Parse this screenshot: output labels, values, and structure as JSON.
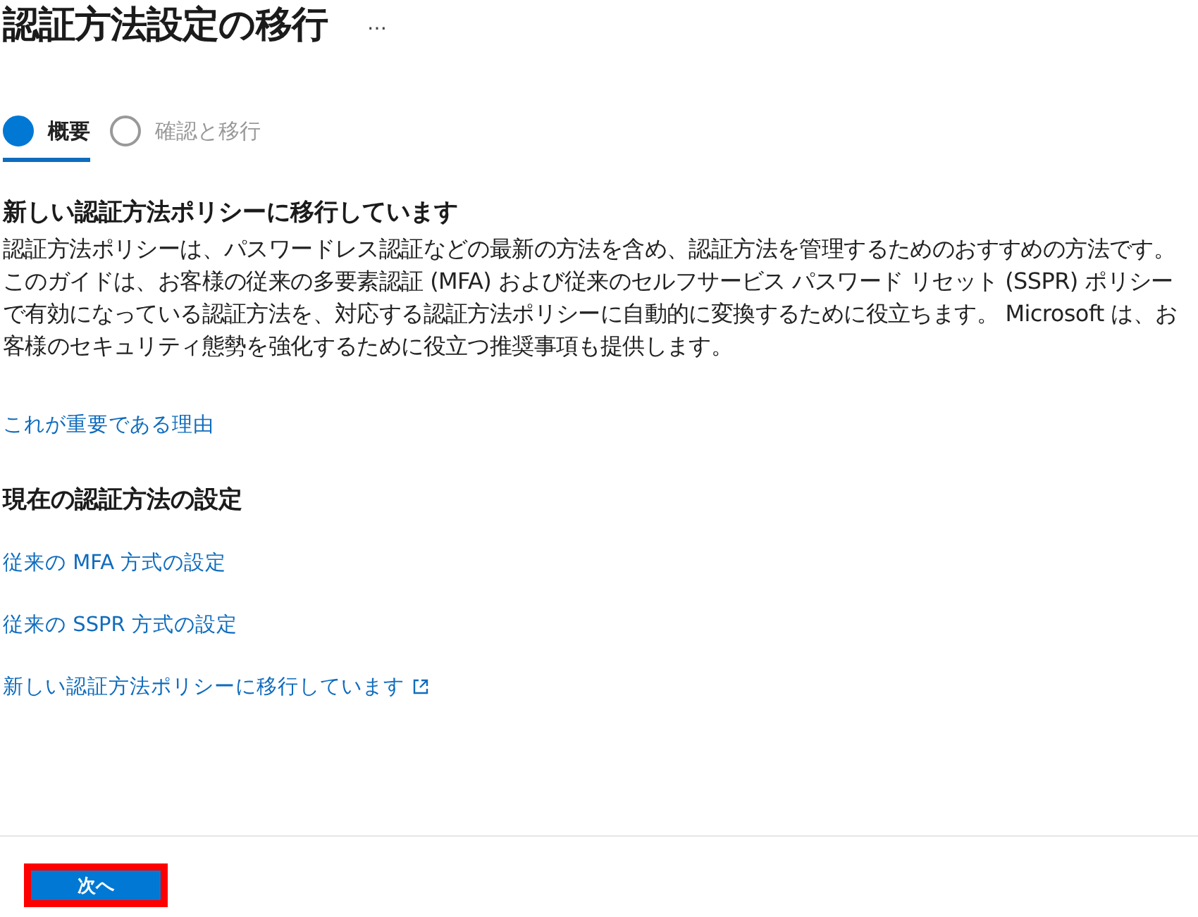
{
  "page": {
    "title": "認証方法設定の移行",
    "more": "…"
  },
  "steps": [
    {
      "label": "概要",
      "selected": true
    },
    {
      "label": "確認と移行",
      "selected": false
    }
  ],
  "intro": {
    "heading": "新しい認証方法ポリシーに移行しています",
    "text": "認証方法ポリシーは、パスワードレス認証などの最新の方法を含め、認証方法を管理するためのおすすめの方法です。このガイドは、お客様の従来の多要素認証 (MFA) および従来のセルフサービス パスワード リセット (SSPR) ポリシーで有効になっている認証方法を、対応する認証方法ポリシーに自動的に変換するために役立ちます。 Microsoft は、お客様のセキュリティ態勢を強化するために役立つ推奨事項も提供します。",
    "link": "これが重要である理由"
  },
  "current": {
    "heading": "現在の認証方法の設定",
    "links": [
      {
        "label": "従来の MFA 方式の設定",
        "external": false
      },
      {
        "label": "従来の SSPR 方式の設定",
        "external": false
      },
      {
        "label": "新しい認証方法ポリシーに移行しています",
        "external": true
      }
    ]
  },
  "footer": {
    "button": "次へ",
    "highlighted": true
  }
}
